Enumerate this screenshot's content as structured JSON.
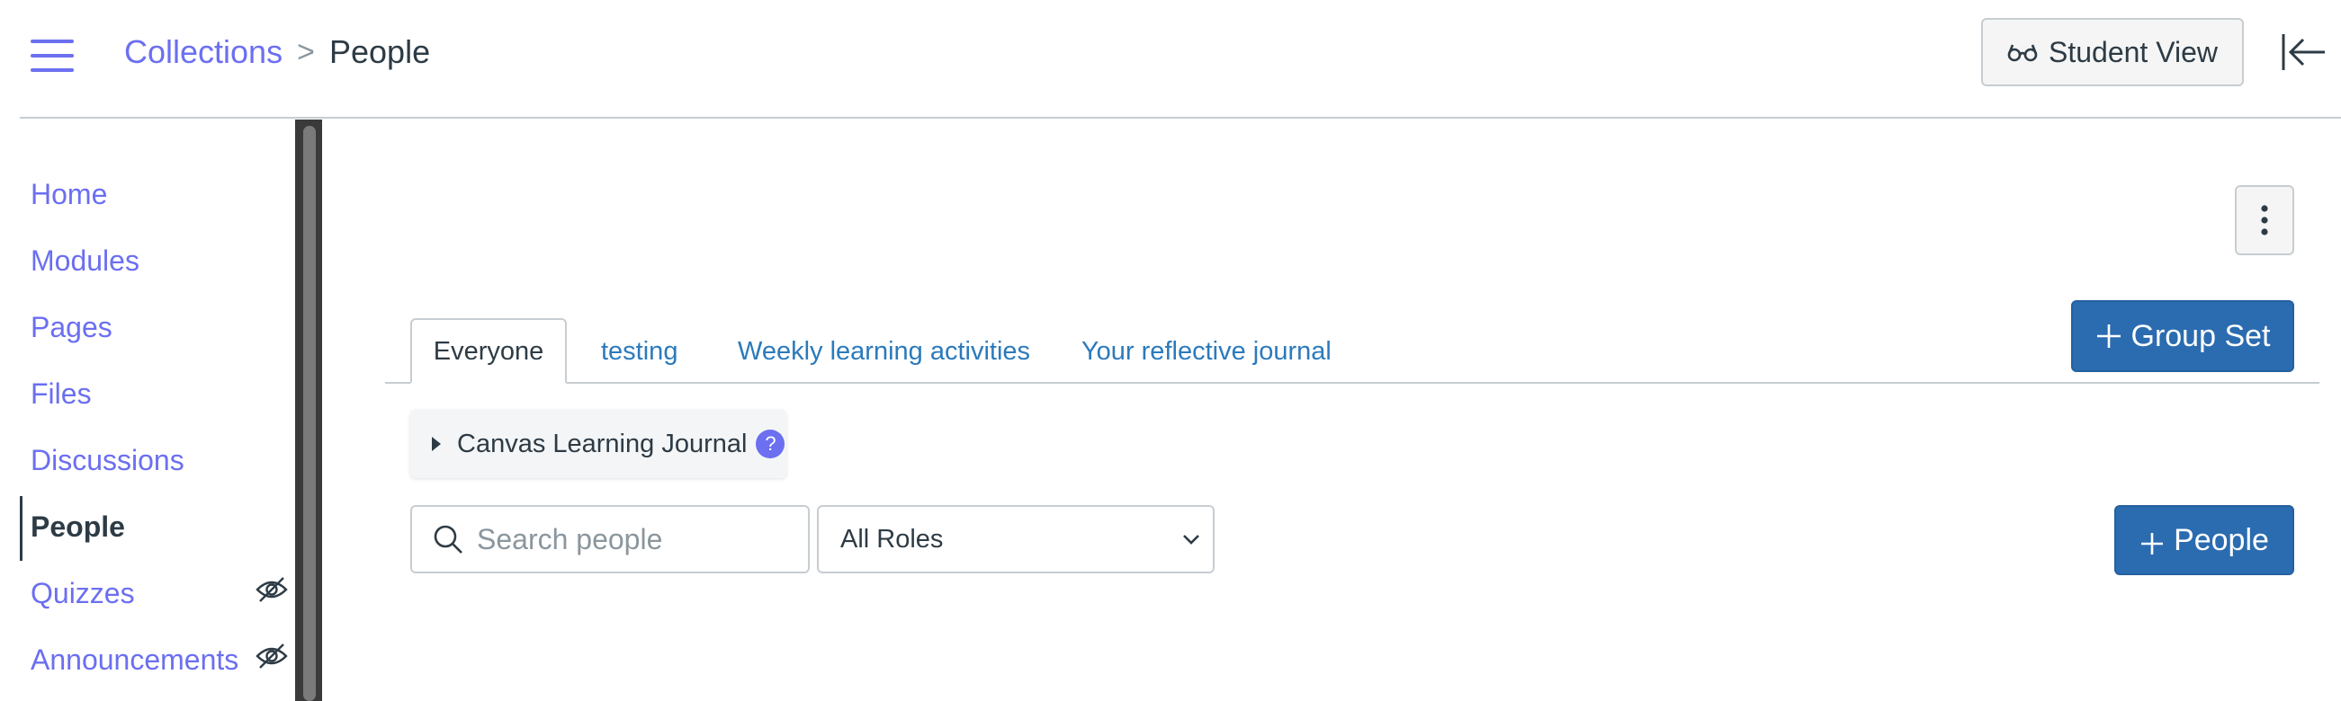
{
  "header": {
    "breadcrumb": {
      "parent": "Collections",
      "separator": ">",
      "current": "People"
    },
    "student_view_label": "Student View"
  },
  "sidebar": {
    "items": [
      {
        "label": "Home",
        "active": false,
        "hidden": false
      },
      {
        "label": "Modules",
        "active": false,
        "hidden": false
      },
      {
        "label": "Pages",
        "active": false,
        "hidden": false
      },
      {
        "label": "Files",
        "active": false,
        "hidden": false
      },
      {
        "label": "Discussions",
        "active": false,
        "hidden": false
      },
      {
        "label": "People",
        "active": true,
        "hidden": false
      },
      {
        "label": "Quizzes",
        "active": false,
        "hidden": true
      },
      {
        "label": "Announcements",
        "active": false,
        "hidden": true
      }
    ]
  },
  "main": {
    "tabs": [
      {
        "label": "Everyone",
        "active": true
      },
      {
        "label": "testing",
        "active": false
      },
      {
        "label": "Weekly learning activities",
        "active": false
      },
      {
        "label": "Your reflective journal",
        "active": false
      }
    ],
    "group_set_button": "Group Set",
    "journal_label": "Canvas Learning Journal",
    "journal_help": "?",
    "search": {
      "placeholder": "Search people",
      "value": ""
    },
    "roles_select": {
      "selected": "All Roles"
    },
    "add_people_button": "People"
  },
  "icons": {
    "menu": "hamburger-icon",
    "student_view": "glasses-icon",
    "collapse": "collapse-left-icon",
    "kebab": "kebab-icon",
    "hidden": "eye-slash-icon",
    "search": "search-icon",
    "select": "chevron-down-icon",
    "plus": "plus-icon"
  },
  "colors": {
    "link": "#6b6ff0",
    "tab_link": "#2b7abc",
    "primary_button": "#2b6cb0",
    "text": "#2d3b45",
    "border": "#c7cdd1"
  }
}
